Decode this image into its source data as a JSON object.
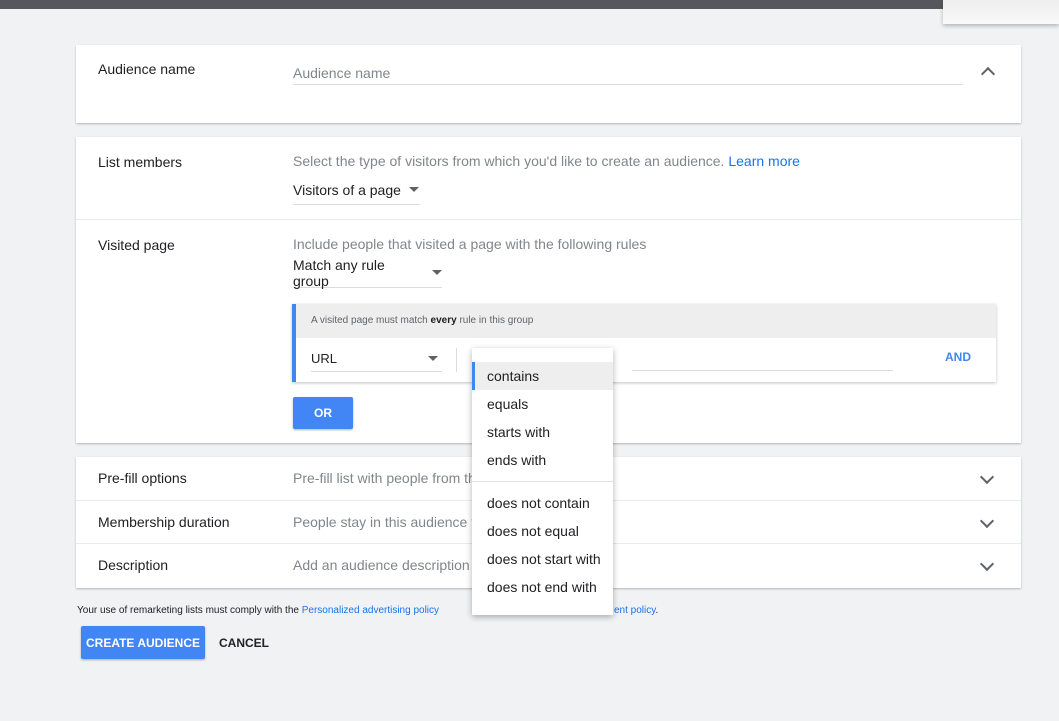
{
  "audience_name": {
    "label": "Audience name",
    "placeholder": "Audience name"
  },
  "list_members": {
    "label": "List members",
    "description": "Select the type of visitors from which you'd like to create an audience.",
    "learn_more": "Learn more",
    "selected": "Visitors of a page"
  },
  "visited_page": {
    "label": "Visited page",
    "description": "Include people that visited a page with the following rules",
    "match_selected": "Match any rule group",
    "rule_group": {
      "header_prefix": "A visited page must match",
      "header_emphasis": "every",
      "header_suffix": "rule in this group",
      "field": "URL",
      "and_label": "AND"
    },
    "or_label": "OR"
  },
  "operator_menu": {
    "selected_index": 0,
    "group_positive": [
      "contains",
      "equals",
      "starts with",
      "ends with"
    ],
    "group_negative": [
      "does not contain",
      "does not equal",
      "does not start with",
      "does not end with"
    ]
  },
  "collapsed_rows": [
    {
      "label": "Pre-fill options",
      "summary": "Pre-fill list with people from th"
    },
    {
      "label": "Membership duration",
      "summary": "People stay in this audience fo"
    },
    {
      "label": "Description",
      "summary": "Add an audience description ("
    }
  ],
  "footer": {
    "text_prefix": "Your use of remarketing lists must comply with the",
    "policy_link": "Personalized advertising policy",
    "policy_link_2": "ent policy",
    "text_suffix": "."
  },
  "actions": {
    "create": "CREATE AUDIENCE",
    "cancel": "CANCEL"
  },
  "colors": {
    "accent": "#4285f4",
    "link": "#1a73e8",
    "background": "#f1f2f4"
  }
}
